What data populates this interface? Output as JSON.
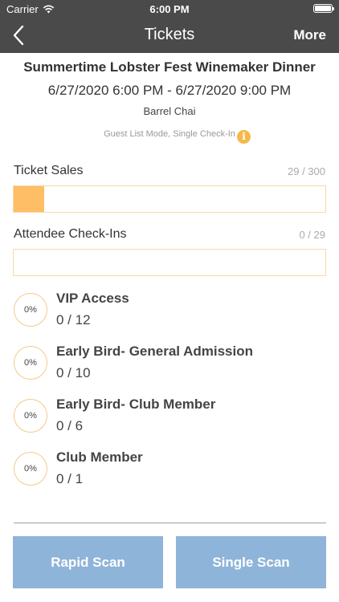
{
  "status_bar": {
    "carrier": "Carrier",
    "time": "6:00 PM"
  },
  "nav": {
    "title": "Tickets",
    "more_label": "More"
  },
  "event": {
    "title": "Summertime Lobster Fest Winemaker Dinner",
    "dates": "6/27/2020 6:00 PM - 6/27/2020 9:00 PM",
    "venue": "Barrel Chai",
    "mode": "Guest List Mode, Single Check-In"
  },
  "ticket_sales": {
    "label": "Ticket Sales",
    "count": "29 / 300",
    "fraction": 0.0967
  },
  "check_ins": {
    "label": "Attendee Check-Ins",
    "count": "0 / 29",
    "fraction": 0
  },
  "ticket_types": [
    {
      "percent": "0%",
      "name": "VIP Access",
      "count": "0 / 12"
    },
    {
      "percent": "0%",
      "name": "Early Bird- General Admission",
      "count": "0 / 10"
    },
    {
      "percent": "0%",
      "name": "Early Bird- Club Member",
      "count": "0 / 6"
    },
    {
      "percent": "0%",
      "name": "Club Member",
      "count": "0 / 1"
    }
  ],
  "buttons": {
    "rapid_scan": "Rapid Scan",
    "single_scan": "Single Scan"
  },
  "colors": {
    "header": "#4a4a4a",
    "accent": "#fdbe66",
    "button": "#8fb4d9"
  }
}
